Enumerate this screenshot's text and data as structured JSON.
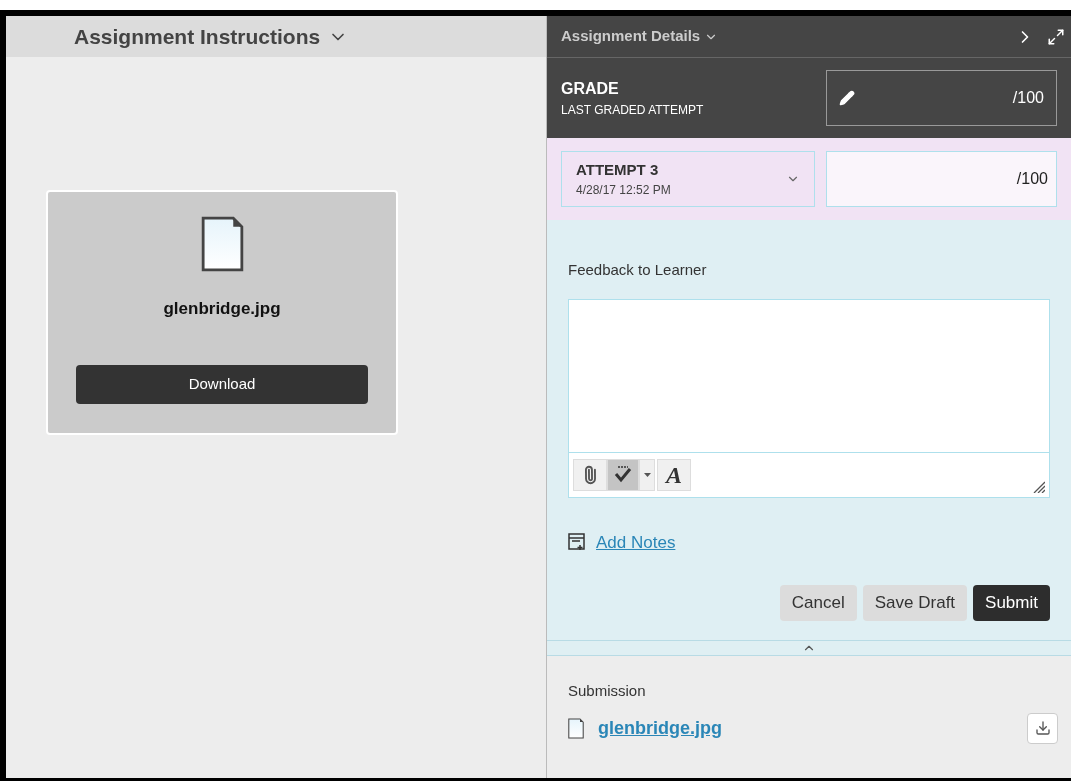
{
  "instructions": {
    "title": "Assignment Instructions",
    "file": {
      "name": "glenbridge.jpg",
      "button": "Download"
    }
  },
  "details": {
    "title": "Assignment Details",
    "grade": {
      "label": "GRADE",
      "sublabel": "LAST GRADED ATTEMPT",
      "out_of": "/100"
    },
    "attempt": {
      "label": "ATTEMPT 3",
      "date": "4/28/17 12:52 PM",
      "out_of": "/100"
    },
    "feedback": {
      "label": "Feedback to Learner",
      "toolbar": [
        {
          "kind": "attach",
          "selected": false
        },
        {
          "kind": "spellcheck",
          "selected": true
        },
        {
          "kind": "font",
          "glyph": "A",
          "selected": false
        }
      ]
    },
    "add_notes": "Add Notes",
    "buttons": [
      {
        "label": "Cancel",
        "kind": "secondary"
      },
      {
        "label": "Save Draft",
        "kind": "secondary"
      },
      {
        "label": "Submit",
        "kind": "primary"
      }
    ],
    "submission": {
      "label": "Submission",
      "file": "glenbridge.jpg"
    }
  }
}
